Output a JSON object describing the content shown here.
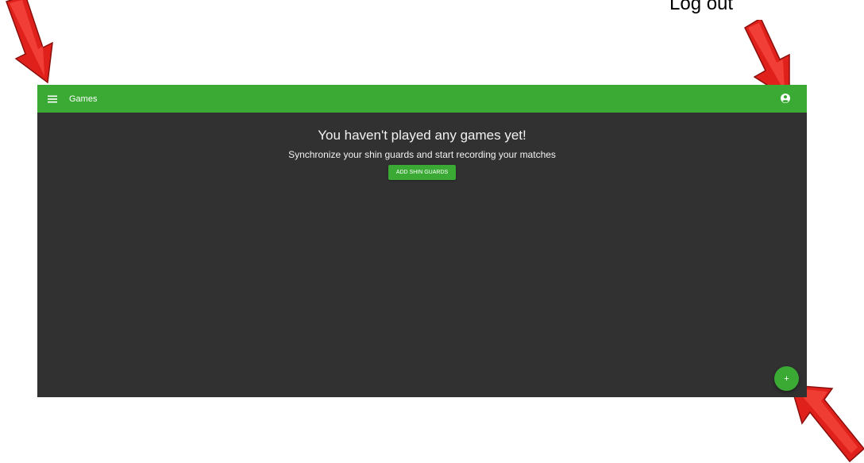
{
  "annotation": {
    "logout_label": "Log out"
  },
  "toolbar": {
    "title": "Games",
    "menu_icon": "menu-icon",
    "account_icon": "account-circle-icon"
  },
  "empty_state": {
    "title": "You haven't played any games yet!",
    "subtitle": "Synchronize your shin guards and start recording your matches",
    "button_label": "ADD SHIN GUARDS"
  },
  "fab": {
    "label": "+",
    "icon": "plus-icon"
  },
  "colors": {
    "primary_green": "#3aaa35",
    "background_dark": "#313131",
    "arrow_red": "#e0201b",
    "text_light": "#f2f2f2"
  }
}
